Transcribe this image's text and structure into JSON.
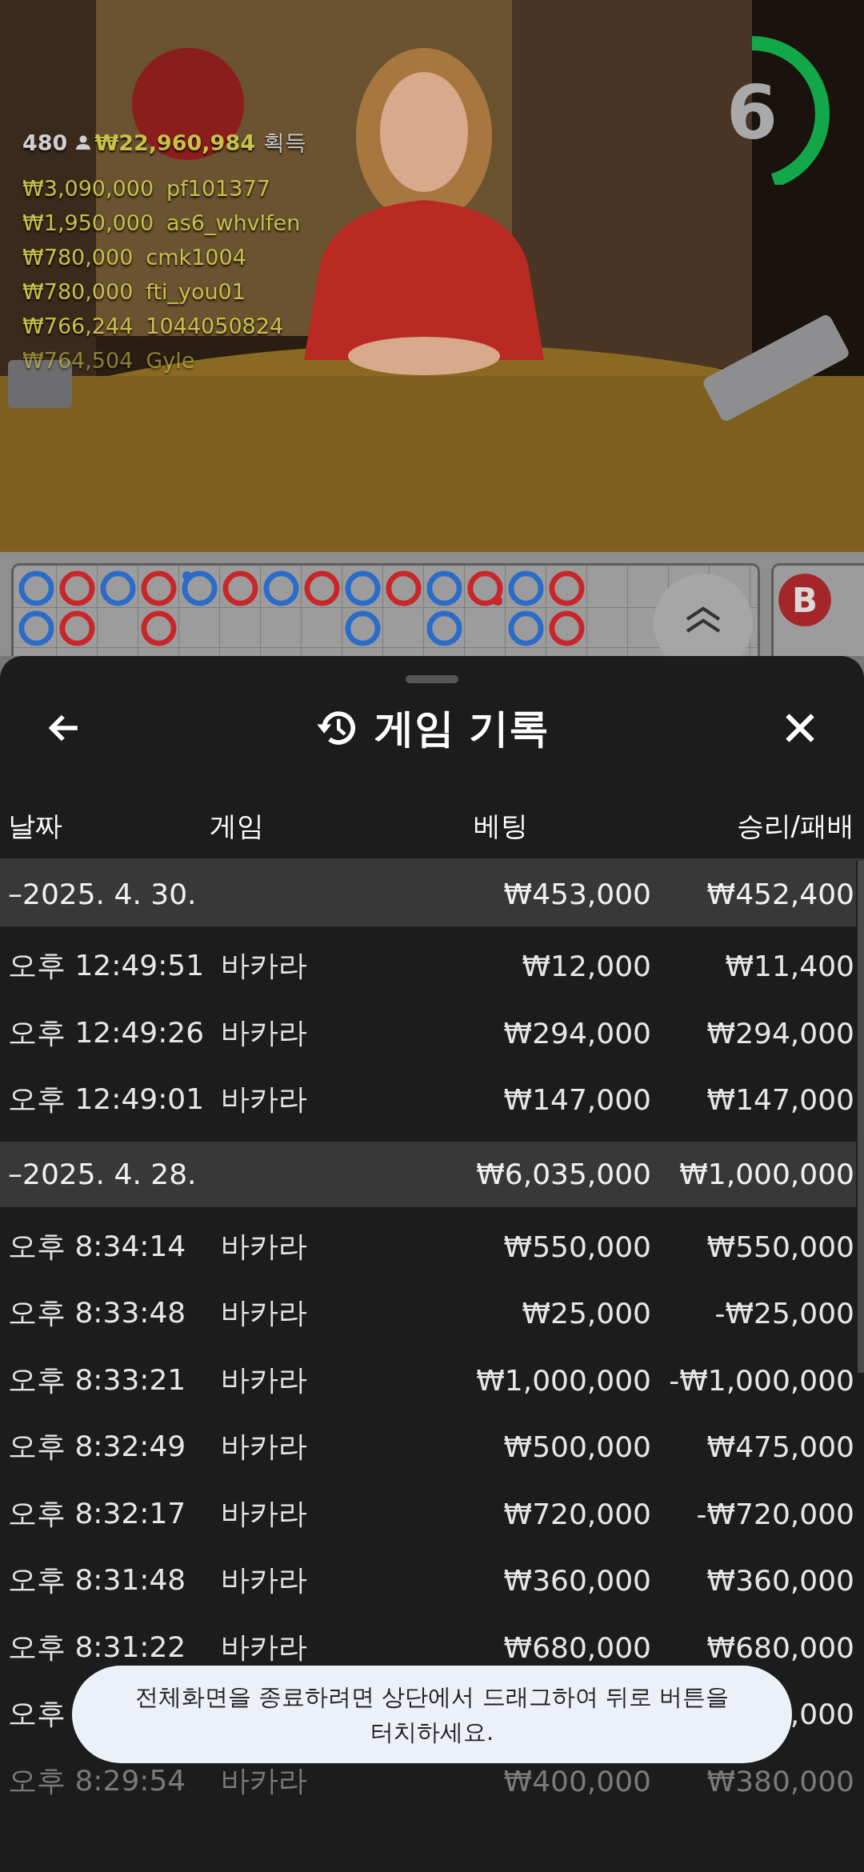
{
  "video": {
    "players": "480",
    "total_won": "₩22,960,984",
    "won_label": "획득",
    "winners": [
      {
        "amount": "₩3,090,000",
        "name": "pf101377",
        "faded": false
      },
      {
        "amount": "₩1,950,000",
        "name": "as6_whvlfen",
        "faded": false
      },
      {
        "amount": "₩780,000",
        "name": "cmk1004",
        "faded": false
      },
      {
        "amount": "₩780,000",
        "name": "fti_you01",
        "faded": false
      },
      {
        "amount": "₩766,244",
        "name": "1044050824",
        "faded": false
      },
      {
        "amount": "₩764,504",
        "name": "Gyle",
        "faded": true
      }
    ],
    "timer": {
      "value": "6",
      "level": 0.45
    }
  },
  "road": {
    "rows": [
      [
        {
          "kind": "player",
          "dot": false
        },
        {
          "kind": "banker",
          "dot": false
        },
        {
          "kind": "player",
          "dot": false
        },
        {
          "kind": "banker",
          "dot": false
        },
        {
          "kind": "player",
          "dot": true
        },
        {
          "kind": "banker",
          "dot": false
        },
        {
          "kind": "player",
          "dot": false
        },
        {
          "kind": "banker",
          "dot": false
        },
        {
          "kind": "player",
          "dot": false
        },
        {
          "kind": "banker",
          "dot": false
        },
        {
          "kind": "player",
          "dot": false
        },
        {
          "kind": "banker",
          "dot": true
        },
        {
          "kind": "player",
          "dot": false
        },
        {
          "kind": "banker",
          "dot": false
        }
      ],
      [
        {
          "kind": "player",
          "dot": false
        },
        {
          "kind": "banker",
          "dot": false
        },
        {
          "kind": "empty"
        },
        {
          "kind": "banker",
          "dot": false
        },
        {
          "kind": "empty"
        },
        {
          "kind": "empty"
        },
        {
          "kind": "empty"
        },
        {
          "kind": "empty"
        },
        {
          "kind": "player",
          "dot": false
        },
        {
          "kind": "empty"
        },
        {
          "kind": "player",
          "dot": false
        },
        {
          "kind": "empty"
        },
        {
          "kind": "player",
          "dot": false
        },
        {
          "kind": "banker",
          "dot": false
        }
      ]
    ],
    "side_label": "B"
  },
  "sheet": {
    "title": "게임 기록",
    "columns": [
      "날짜",
      "게임",
      "베팅",
      "승리/패배"
    ],
    "groups": [
      {
        "date": "–2025. 4. 30.",
        "bet": "₩453,000",
        "result": "₩452,400",
        "rows": [
          {
            "time": "오후 12:49:51",
            "game": "바카라",
            "bet": "₩12,000",
            "result": "₩11,400",
            "faded": false
          },
          {
            "time": "오후 12:49:26",
            "game": "바카라",
            "bet": "₩294,000",
            "result": "₩294,000",
            "faded": false
          },
          {
            "time": "오후 12:49:01",
            "game": "바카라",
            "bet": "₩147,000",
            "result": "₩147,000",
            "faded": false
          }
        ]
      },
      {
        "date": "–2025. 4. 28.",
        "bet": "₩6,035,000",
        "result": "₩1,000,000",
        "rows": [
          {
            "time": "오후 8:34:14",
            "game": "바카라",
            "bet": "₩550,000",
            "result": "₩550,000",
            "faded": false
          },
          {
            "time": "오후 8:33:48",
            "game": "바카라",
            "bet": "₩25,000",
            "result": "-₩25,000",
            "faded": false
          },
          {
            "time": "오후 8:33:21",
            "game": "바카라",
            "bet": "₩1,000,000",
            "result": "-₩1,000,000",
            "faded": false
          },
          {
            "time": "오후 8:32:49",
            "game": "바카라",
            "bet": "₩500,000",
            "result": "₩475,000",
            "faded": false
          },
          {
            "time": "오후 8:32:17",
            "game": "바카라",
            "bet": "₩720,000",
            "result": "-₩720,000",
            "faded": false
          },
          {
            "time": "오후 8:31:48",
            "game": "바카라",
            "bet": "₩360,000",
            "result": "₩360,000",
            "faded": false
          },
          {
            "time": "오후 8:31:22",
            "game": "바카라",
            "bet": "₩680,000",
            "result": "₩680,000",
            "faded": false
          },
          {
            "time": "오후",
            "result": ",000",
            "faded": false
          },
          {
            "time": "오후 8:29:54",
            "game": "바카라",
            "bet": "₩400,000",
            "result": "₩380,000",
            "faded": true
          }
        ]
      }
    ]
  },
  "toast": "전체화면을 종료하려면 상단에서 드래그하여 뒤로 버튼을 터치하세요."
}
